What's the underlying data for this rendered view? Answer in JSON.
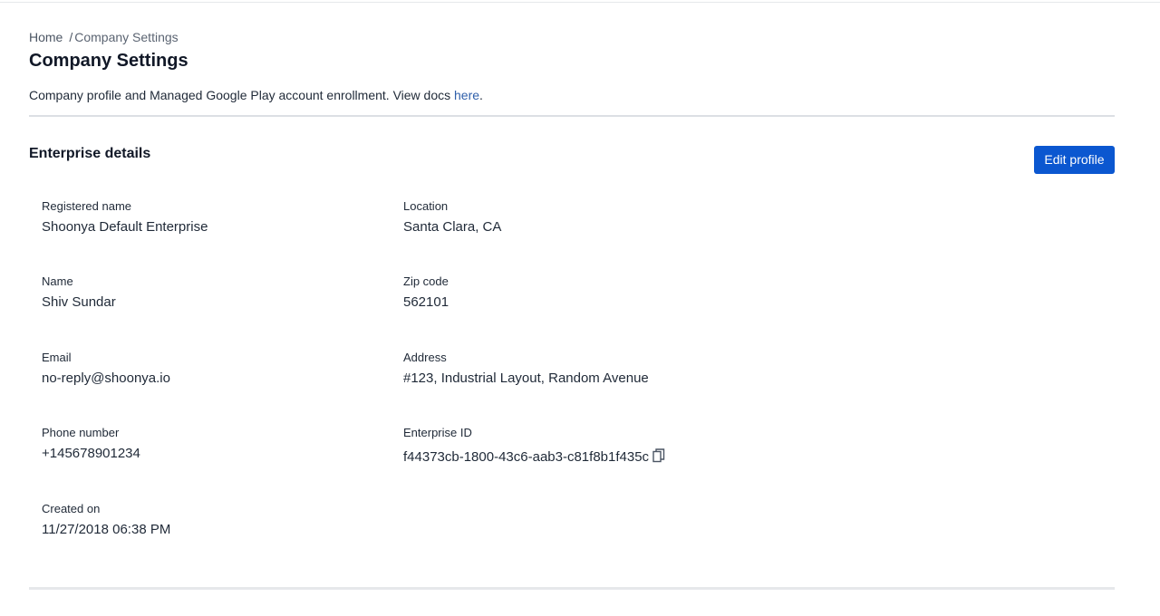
{
  "breadcrumb": {
    "home": "Home",
    "separator": "/",
    "current": "Company Settings"
  },
  "page": {
    "title": "Company Settings",
    "description_prefix": "Company profile and Managed Google Play account enrollment. View docs ",
    "docs_link": "here",
    "description_suffix": "."
  },
  "section": {
    "title": "Enterprise details",
    "edit_button": "Edit profile"
  },
  "fields": {
    "registered_name": {
      "label": "Registered name",
      "value": "Shoonya Default Enterprise"
    },
    "location": {
      "label": "Location",
      "value": "Santa Clara, CA"
    },
    "name": {
      "label": "Name",
      "value": "Shiv Sundar"
    },
    "zip_code": {
      "label": "Zip code",
      "value": "562101"
    },
    "email": {
      "label": "Email",
      "value": "no-reply@shoonya.io"
    },
    "address": {
      "label": "Address",
      "value": "#123, Industrial Layout, Random Avenue"
    },
    "phone_number": {
      "label": "Phone number",
      "value": "+145678901234"
    },
    "enterprise_id": {
      "label": "Enterprise ID",
      "value": "f44373cb-1800-43c6-aab3-c81f8b1f435c"
    },
    "created_on": {
      "label": "Created on",
      "value": "11/27/2018 06:38 PM"
    }
  },
  "icons": {
    "copy": "copy-icon"
  },
  "colors": {
    "primary_button": "#0b57d0",
    "link": "#2f5faa",
    "divider": "#dcdfe4"
  }
}
